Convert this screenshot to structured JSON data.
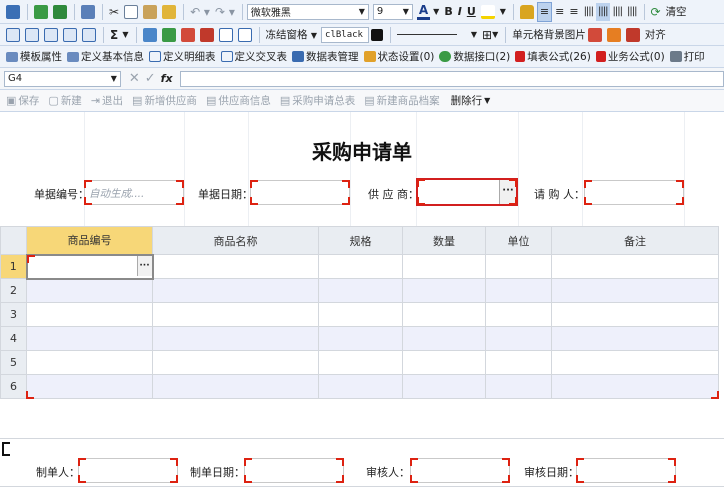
{
  "toolbar1": {
    "font_name": "微软雅黑",
    "font_size": "9",
    "bold": "B",
    "italic": "I",
    "underline": "U",
    "clear_label": "清空"
  },
  "toolbar2": {
    "sigma": "Σ",
    "freeze_label": "冻结窗格",
    "color_value": "clBlack",
    "cell_bg_label": "单元格背景图片",
    "align_label": "对齐"
  },
  "toolbar3": {
    "items": [
      "模板属性",
      "定义基本信息",
      "定义明细表",
      "定义交叉表",
      "数据表管理",
      "状态设置(0)",
      "数据接口(2)",
      "填表公式(26)",
      "业务公式(0)",
      "打印"
    ]
  },
  "formula_bar": {
    "cell_ref": "G4",
    "fx": "fx"
  },
  "actions": {
    "items": [
      "保存",
      "新建",
      "退出",
      "新增供应商",
      "供应商信息",
      "采购申请总表",
      "新建商品档案"
    ],
    "delete_row": "删除行"
  },
  "form": {
    "title": "采购申请单",
    "doc_no_label": "单据编号：",
    "doc_no_placeholder": "自动生成....",
    "doc_date_label": "单据日期：",
    "supplier_label": "供 应 商：",
    "requester_label": "请 购 人：",
    "ellipsis": "···"
  },
  "table": {
    "columns": [
      "商品编号",
      "商品名称",
      "规格",
      "数量",
      "单位",
      "备注"
    ],
    "rows": [
      "1",
      "2",
      "3",
      "4",
      "5",
      "6"
    ]
  },
  "footer": {
    "maker_label": "制单人：",
    "make_date_label": "制单日期：",
    "auditor_label": "审核人：",
    "audit_date_label": "审核日期："
  },
  "colors": {
    "accent_red": "#d21f1f",
    "selected_header": "#f7d778",
    "toolbar_bg": "#eef3fa",
    "alt_row": "#eef0fb"
  }
}
